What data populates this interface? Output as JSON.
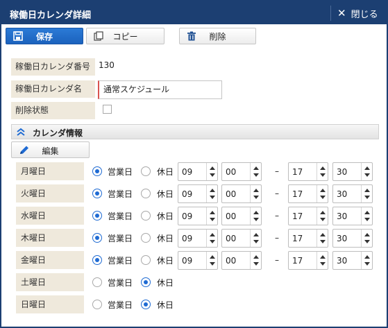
{
  "window": {
    "title": "稼働日カレンダ詳細",
    "close_label": "閉じる"
  },
  "toolbar": {
    "save_label": "保存",
    "copy_label": "コピー",
    "delete_label": "削除"
  },
  "form": {
    "number_label": "稼働日カレンダ番号",
    "number_value": "130",
    "name_label": "稼働日カレンダ名",
    "name_value": "通常スケジュール",
    "deleted_label": "削除状態",
    "deleted_checked": false
  },
  "section": {
    "title": "カレンダ情報",
    "edit_label": "編集"
  },
  "labels": {
    "business_day": "営業日",
    "holiday": "休日",
    "range_sep": "–"
  },
  "days": [
    {
      "name": "月曜日",
      "business": true,
      "start_h": "09",
      "start_m": "00",
      "end_h": "17",
      "end_m": "30"
    },
    {
      "name": "火曜日",
      "business": true,
      "start_h": "09",
      "start_m": "00",
      "end_h": "17",
      "end_m": "30"
    },
    {
      "name": "水曜日",
      "business": true,
      "start_h": "09",
      "start_m": "00",
      "end_h": "17",
      "end_m": "30"
    },
    {
      "name": "木曜日",
      "business": true,
      "start_h": "09",
      "start_m": "00",
      "end_h": "17",
      "end_m": "30"
    },
    {
      "name": "金曜日",
      "business": true,
      "start_h": "09",
      "start_m": "00",
      "end_h": "17",
      "end_m": "30"
    },
    {
      "name": "土曜日",
      "business": false
    },
    {
      "name": "日曜日",
      "business": false
    }
  ],
  "colors": {
    "titlebar": "#1c3f72",
    "primary": "#1f6bd3",
    "label_bg": "#efe9dc"
  },
  "icons": {
    "save": "save-icon",
    "copy": "copy-icon",
    "delete": "trash-icon",
    "close": "close-icon",
    "collapse": "chevron-up-double-icon",
    "edit": "pencil-icon"
  }
}
